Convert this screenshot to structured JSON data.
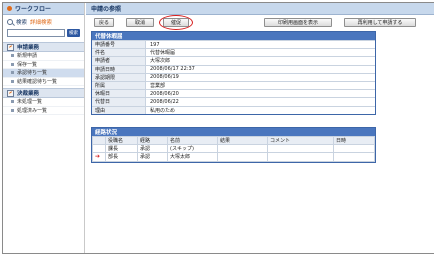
{
  "sidebar": {
    "title": "ワークフロー",
    "search_label": "検索",
    "advanced_search": "詳細検索",
    "search_button": "検索",
    "sections": [
      {
        "title": "申請業務",
        "items": [
          "新規申請",
          "保存一覧",
          "承認待ち一覧",
          "結果確認待ち一覧"
        ]
      },
      {
        "title": "決裁業務",
        "items": [
          "未処理一覧",
          "処理済み一覧"
        ]
      }
    ]
  },
  "main": {
    "title": "申請の参照",
    "buttons": {
      "back": "戻る",
      "cancel": "取消",
      "remind": "催促",
      "print": "印刷用画面を表示",
      "reuse": "再利用して申請する"
    },
    "request_panel": {
      "title": "代替休暇届",
      "rows": [
        {
          "key": "申請番号",
          "value": "197"
        },
        {
          "key": "件名",
          "value": "代替休暇届"
        },
        {
          "key": "申請者",
          "value": "大塚次郎"
        },
        {
          "key": "申請日時",
          "value": "2008/06/17 22:37"
        },
        {
          "key": "承認期限",
          "value": "2008/06/19"
        },
        {
          "key": "所属",
          "value": "営業部"
        },
        {
          "key": "休暇日",
          "value": "2008/06/20"
        },
        {
          "key": "代替日",
          "value": "2008/06/22"
        },
        {
          "key": "理由",
          "value": "私用のため"
        }
      ]
    },
    "route_panel": {
      "title": "経路状況",
      "columns": [
        "",
        "役職名",
        "経路",
        "名前",
        "結果",
        "コメント",
        "日時"
      ],
      "rows": [
        {
          "marker": "",
          "role": "課長",
          "route": "承認",
          "name": "(スキップ)",
          "result": "",
          "comment": "",
          "datetime": ""
        },
        {
          "marker": "current",
          "role": "部長",
          "route": "承認",
          "name": "大塚太郎",
          "result": "",
          "comment": "",
          "datetime": ""
        }
      ]
    }
  },
  "colors": {
    "panel_header": "#4a76be",
    "title_bar": "#c7d8ec",
    "highlight_oval": "#d61f1f",
    "accent_orange": "#e06b1a"
  }
}
